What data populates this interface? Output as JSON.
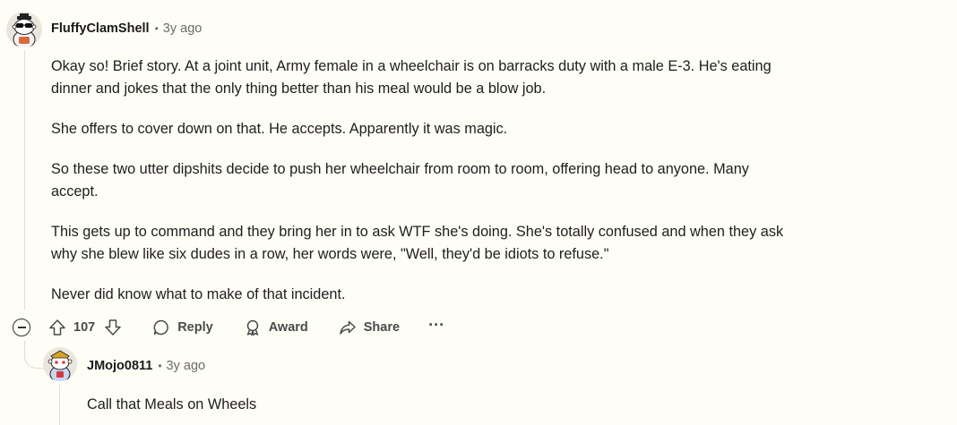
{
  "comment": {
    "author": "FluffyClamShell",
    "separator": "•",
    "time": "3y ago",
    "paragraphs": [
      "Okay so! Brief story. At a joint unit, Army female in a wheelchair is on barracks duty with a male E-3. He's eating dinner and jokes that the only thing better than his meal would be a blow job.",
      "She offers to cover down on that. He accepts. Apparently it was magic.",
      "So these two utter dipshits decide to push her wheelchair from room to room, offering head to anyone. Many accept.",
      "This gets up to command and they bring her in to ask WTF she's doing. She's totally confused and when they ask why she blew like six dudes in a row, her words were, \"Well, they'd be idiots to refuse.\"",
      "Never did know what to make of that incident."
    ],
    "actions": {
      "vote_count": "107",
      "reply_label": "Reply",
      "award_label": "Award",
      "share_label": "Share",
      "more_label": "···"
    }
  },
  "reply": {
    "author": "JMojo0811",
    "separator": "•",
    "time": "3y ago",
    "text": "Call that Meals on Wheels"
  },
  "colors": {
    "background": "#fefdf6",
    "text": "#1e1e1e",
    "meta": "#6b6b6b",
    "thread_line": "#e0ddd2"
  }
}
